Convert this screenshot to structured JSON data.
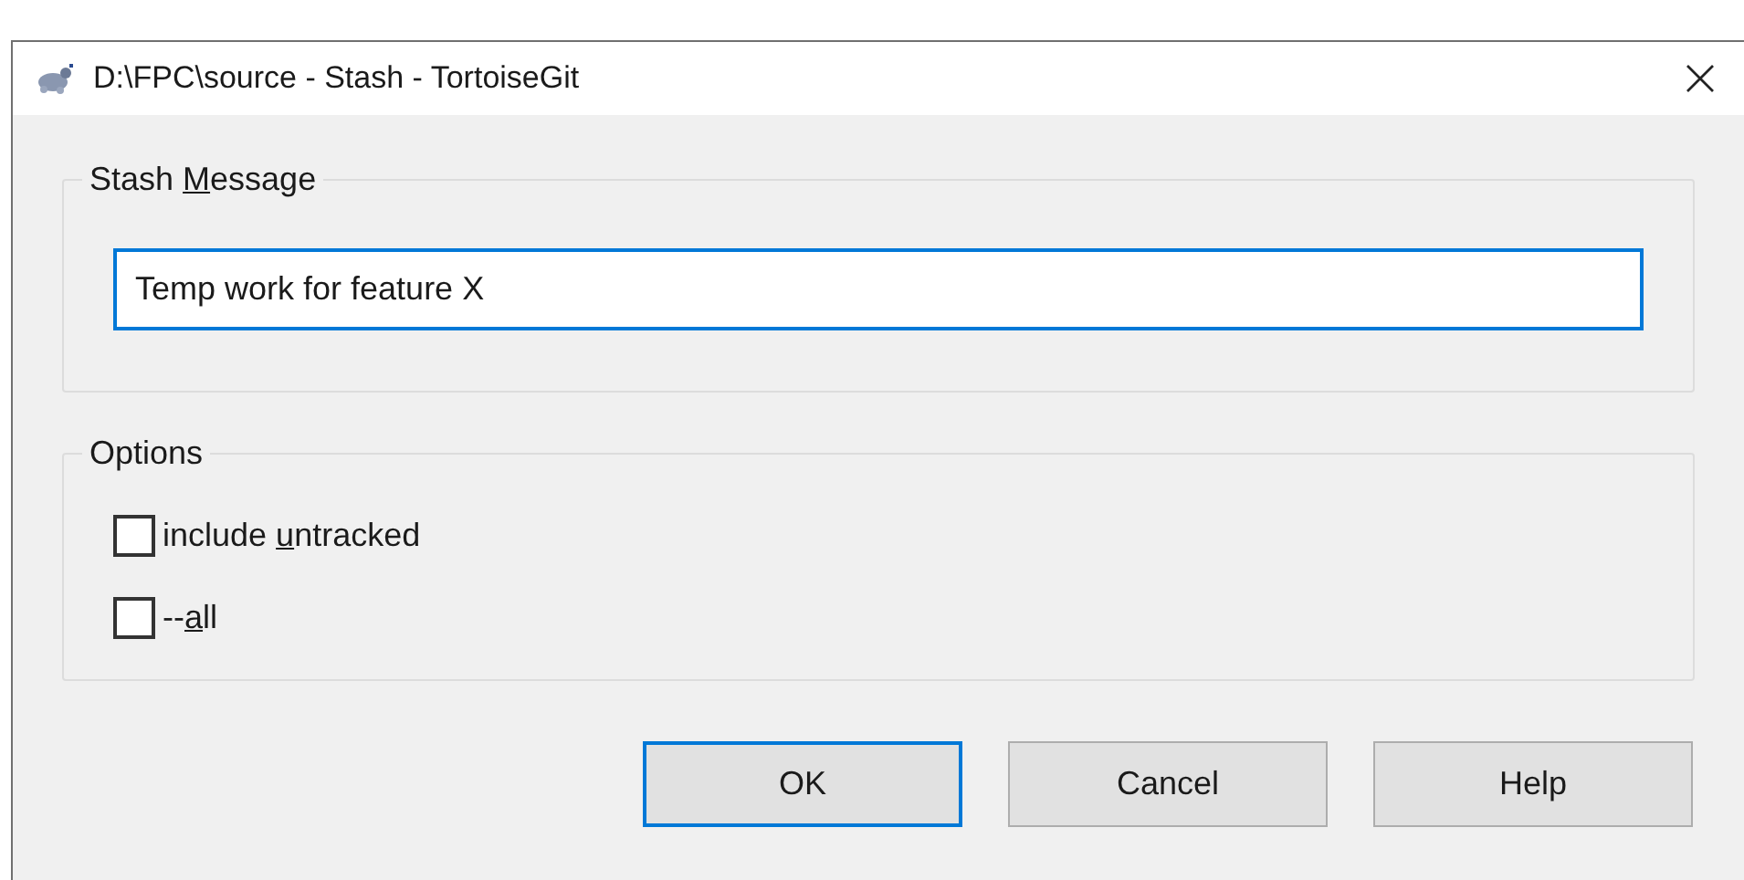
{
  "window": {
    "title": "D:\\FPC\\source - Stash - TortoiseGit"
  },
  "message_group": {
    "label_parts": [
      {
        "text": "Stash ",
        "underlined": false
      },
      {
        "text": "M",
        "underlined": true
      },
      {
        "text": "essage",
        "underlined": false
      }
    ],
    "value": "Temp work for feature X",
    "focused": true
  },
  "options_group": {
    "label": "Options",
    "options": [
      {
        "label_parts": [
          {
            "text": "include ",
            "underlined": false
          },
          {
            "text": "u",
            "underlined": true
          },
          {
            "text": "ntracked",
            "underlined": false
          }
        ],
        "checked": false
      },
      {
        "label_parts": [
          {
            "text": "--",
            "underlined": false
          },
          {
            "text": "a",
            "underlined": true
          },
          {
            "text": "ll",
            "underlined": false
          }
        ],
        "checked": false
      }
    ]
  },
  "buttons": [
    {
      "label": "OK",
      "default": true
    },
    {
      "label": "Cancel",
      "default": false
    },
    {
      "label": "Help",
      "default": false
    }
  ]
}
